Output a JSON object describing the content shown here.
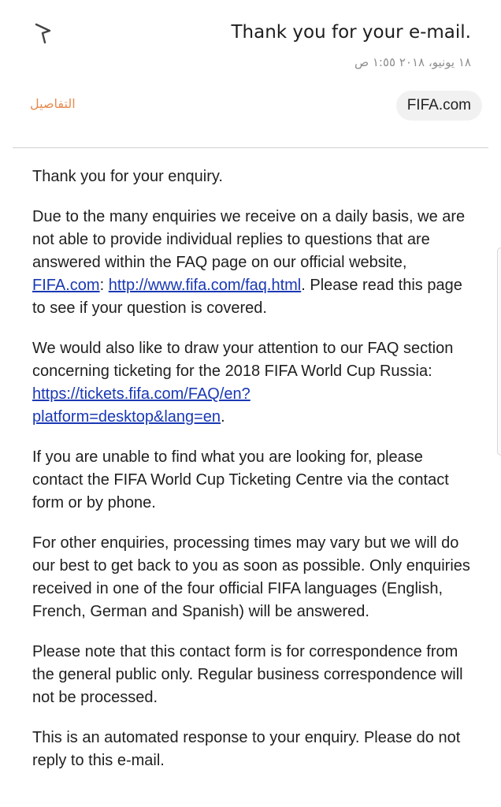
{
  "header": {
    "subject": "Thank you for your e-mail.",
    "date": "١٨ يونيو، ٢٠١٨ ١:٥٥ ص",
    "details_label": "التفاصيل",
    "sender": "FIFA.com",
    "flag_icon": "flag-icon",
    "details_color": "#e88a4e"
  },
  "message": {
    "p1": "Thank you for your enquiry.",
    "p2_text1": "Due to the many enquiries we receive on a daily basis, we are not able to provide individual replies to questions that are answered within the FAQ page on our official website, ",
    "p2_link1": "FIFA.com",
    "p2_text2": ": ",
    "p2_link2": "http://www.fifa.com/faq.html",
    "p2_text3": ". Please read this page to see if your question is covered.",
    "p3_text1": "We would also like to draw your attention to our FAQ section concerning ticketing for the 2018 FIFA World Cup Russia: ",
    "p3_link": "https://tickets.fifa.com/FAQ/en?platform=desktop&lang=en",
    "p3_text2": ".",
    "p4": "If you are unable to find what you are looking for, please contact the FIFA World Cup Ticketing Centre via the contact form or by phone.",
    "p5": "For other enquiries, processing times may vary but we will do our best to get back to you as soon as possible. Only enquiries received in one of the four official FIFA languages (English, French, German and Spanish) will be answered.",
    "p6": "Please note that this contact form is for correspondence from the general public only. Regular business correspondence will not be processed.",
    "p7": "This is an automated response to your enquiry. Please do not reply to this e-mail.",
    "link_color": "#1a39b4"
  }
}
